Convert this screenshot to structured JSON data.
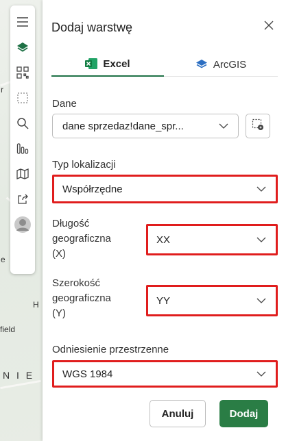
{
  "map": {
    "labels": [
      "field",
      "N I E",
      "r",
      "e",
      "H"
    ]
  },
  "toolbar": {
    "icons": [
      "menu-icon",
      "layers-icon",
      "qr-code-icon",
      "selection-icon",
      "search-icon",
      "chart-icon",
      "map-icon",
      "share-icon",
      "avatar-icon"
    ]
  },
  "panel": {
    "title": "Dodaj warstwę",
    "tabs": [
      {
        "label": "Excel",
        "icon": "excel-icon",
        "active": true
      },
      {
        "label": "ArcGIS",
        "icon": "arcgis-layers-icon",
        "active": false
      }
    ],
    "data": {
      "label": "Dane",
      "value": "dane sprzedaz!dane_spr...",
      "button_icon": "select-range-icon"
    },
    "location_type": {
      "label": "Typ lokalizacji",
      "value": "Współrzędne"
    },
    "longitude": {
      "label_lines": [
        "Długość",
        "geograficzna",
        "(X)"
      ],
      "value": "XX"
    },
    "latitude": {
      "label_lines": [
        "Szerokość",
        "geograficzna",
        "(Y)"
      ],
      "value": "YY"
    },
    "spatial_reference": {
      "label": "Odniesienie przestrzenne",
      "value": "WGS 1984"
    },
    "buttons": {
      "cancel": "Anuluj",
      "add": "Dodaj"
    }
  },
  "colors": {
    "accent_green": "#2a7d45",
    "highlight_red": "#e01d1d",
    "excel_green": "#1e7145",
    "arcgis_blue": "#2b6ec2"
  }
}
